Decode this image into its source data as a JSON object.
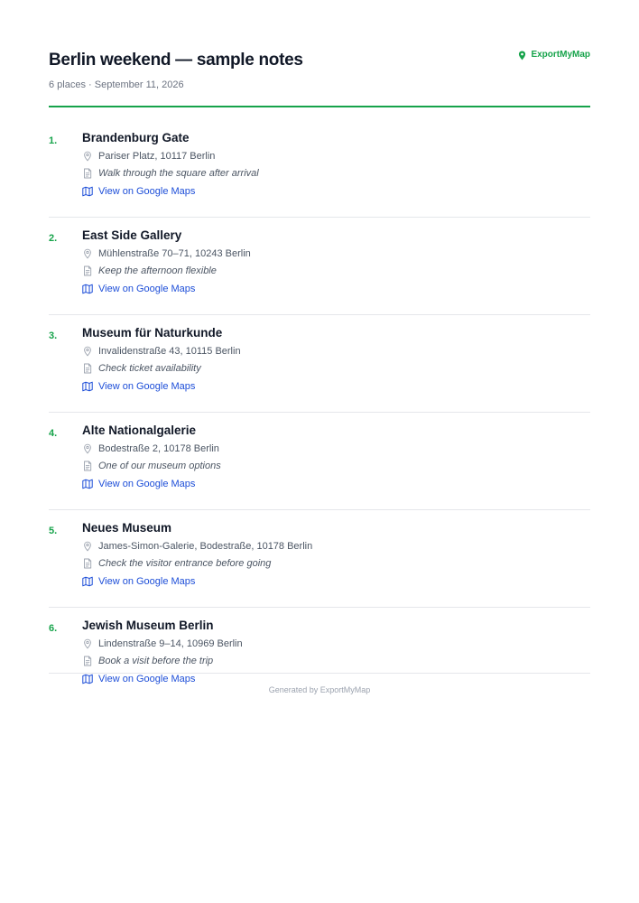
{
  "header": {
    "title": "Berlin weekend — sample notes",
    "subtitle": "6 places · September 11, 2026",
    "brand": "ExportMyMap"
  },
  "places": [
    {
      "number": "1.",
      "name": "Brandenburg Gate",
      "address": "Pariser Platz, 10117 Berlin",
      "note": "Walk through the square after arrival",
      "link": "View on Google Maps"
    },
    {
      "number": "2.",
      "name": "East Side Gallery",
      "address": "Mühlenstraße 70–71, 10243 Berlin",
      "note": "Keep the afternoon flexible",
      "link": "View on Google Maps"
    },
    {
      "number": "3.",
      "name": "Museum für Naturkunde",
      "address": "Invalidenstraße 43, 10115 Berlin",
      "note": "Check ticket availability",
      "link": "View on Google Maps"
    },
    {
      "number": "4.",
      "name": "Alte Nationalgalerie",
      "address": "Bodestraße 2, 10178 Berlin",
      "note": "One of our museum options",
      "link": "View on Google Maps"
    },
    {
      "number": "5.",
      "name": "Neues Museum",
      "address": "James-Simon-Galerie, Bodestraße, 10178 Berlin",
      "note": "Check the visitor entrance before going",
      "link": "View on Google Maps"
    },
    {
      "number": "6.",
      "name": "Jewish Museum Berlin",
      "address": "Lindenstraße 9–14, 10969 Berlin",
      "note": "Book a visit before the trip",
      "link": "View on Google Maps"
    }
  ],
  "footer": {
    "text": "Generated by ExportMyMap"
  },
  "icons": {
    "brand": "map-pin-icon",
    "address": "location-pin-icon",
    "note": "document-icon",
    "link": "map-icon"
  },
  "colors": {
    "accent": "#16a34a",
    "link": "#1d4ed8",
    "title": "#111827",
    "muted": "#6b7280"
  }
}
